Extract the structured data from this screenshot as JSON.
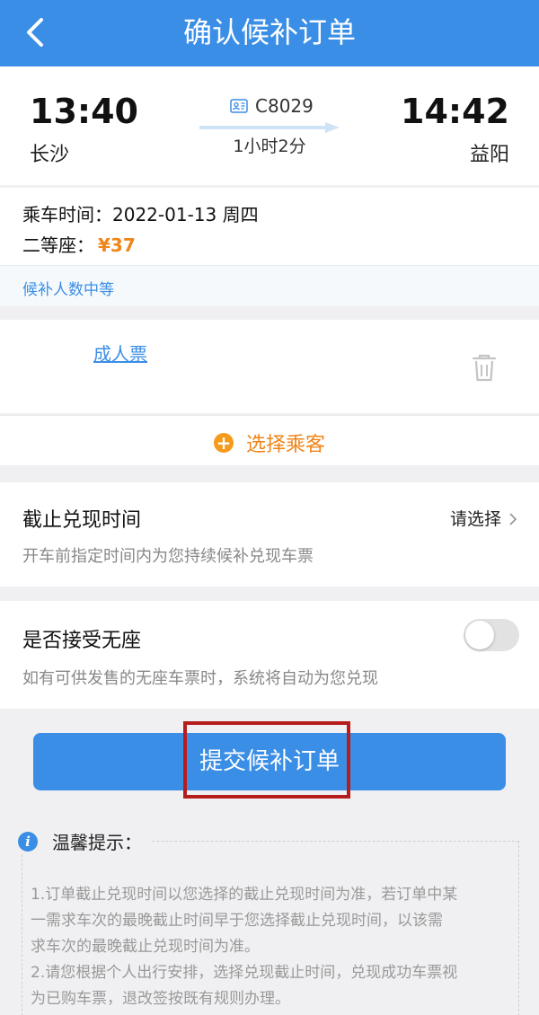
{
  "header": {
    "title": "确认候补订单"
  },
  "train": {
    "departure_time": "13:40",
    "departure_station": "长沙",
    "arrival_time": "14:42",
    "arrival_station": "益阳",
    "train_number": "C8029",
    "duration": "1小时2分"
  },
  "trip_info": {
    "date_label": "乘车时间：",
    "date_value": "2022-01-13 周四",
    "seat_label": "二等座：",
    "price": "¥37",
    "waitlist_status": "候补人数中等"
  },
  "passenger": {
    "ticket_type": "成人票"
  },
  "select_passenger": {
    "label": "选择乘客"
  },
  "deadline": {
    "title": "截止兑现时间",
    "action": "请选择",
    "description": "开车前指定时间内为您持续候补兑现车票"
  },
  "no_seat": {
    "title": "是否接受无座",
    "toggle_on": false,
    "description": "如有可供发售的无座车票时，系统将自动为您兑现"
  },
  "submit": {
    "label": "提交候补订单"
  },
  "tips": {
    "title": "温馨提示：",
    "lines": [
      "1.订单截止兑现时间以您选择的截止兑现时间为准，若订单中某",
      "一需求车次的最晚截止时间早于您选择截止兑现时间，以该需",
      "求车次的最晚截止兑现时间为准。",
      "2.请您根据个人出行安排，选择兑现截止时间，兑现成功车票视",
      "为已购车票，退改签按既有规则办理。"
    ]
  },
  "colors": {
    "primary": "#3a8ee6",
    "accent_orange": "#f08519",
    "highlight_red": "#b71c1c"
  }
}
